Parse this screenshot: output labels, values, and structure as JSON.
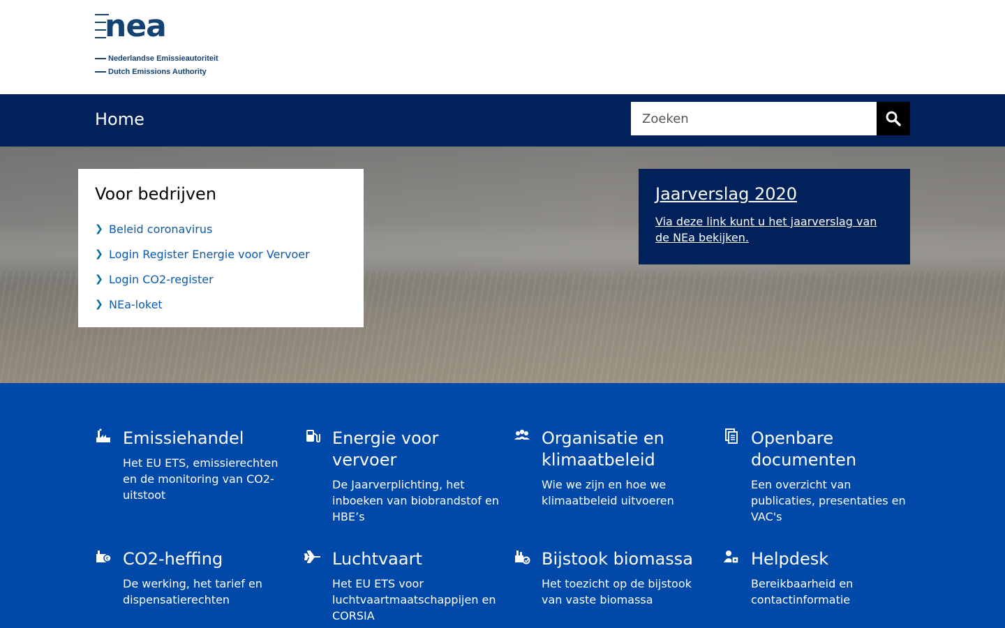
{
  "logo": {
    "word": "nea",
    "line1": "Nederlandse Emissieautoriteit",
    "line2": "Dutch Emissions Authority"
  },
  "nav": {
    "home": "Home",
    "search_placeholder": "Zoeken"
  },
  "bedrijven": {
    "title": "Voor bedrijven",
    "links": [
      "Beleid coronavirus",
      "Login Register Energie voor Vervoer",
      "Login CO2-register",
      "NEa-loket"
    ]
  },
  "jaarverslag": {
    "title": "Jaarverslag 2020",
    "text": "Via deze link kunt u het jaarverslag van de NEa bekijken."
  },
  "tiles": [
    {
      "icon": "factory-icon",
      "title": "Emissiehandel",
      "text": "Het EU ETS, emissierechten en de monitoring van CO2-uitstoot"
    },
    {
      "icon": "fuel-pump-icon",
      "title": "Energie voor vervoer",
      "text": "De Jaarverplichting, het inboeken van biobrandstof en HBE’s"
    },
    {
      "icon": "people-icon",
      "title": "Organisatie en klimaatbeleid",
      "text": "Wie we zijn en hoe we klimaatbeleid uitvoeren"
    },
    {
      "icon": "documents-icon",
      "title": "Openbare documenten",
      "text": "Een overzicht van publicaties, presentaties en VAC's"
    },
    {
      "icon": "co2-tax-icon",
      "title": "CO2-heffing",
      "text": "De werking, het tarief en dispensatierechten"
    },
    {
      "icon": "airplane-icon",
      "title": "Luchtvaart",
      "text": "Het EU ETS voor luchtvaartmaatschappijen en CORSIA"
    },
    {
      "icon": "biomass-icon",
      "title": "Bijstook biomassa",
      "text": "Het toezicht op de bijstook van vaste biomassa"
    },
    {
      "icon": "helpdesk-icon",
      "title": "Helpdesk",
      "text": "Bereikbaarheid en contactinformatie"
    }
  ]
}
